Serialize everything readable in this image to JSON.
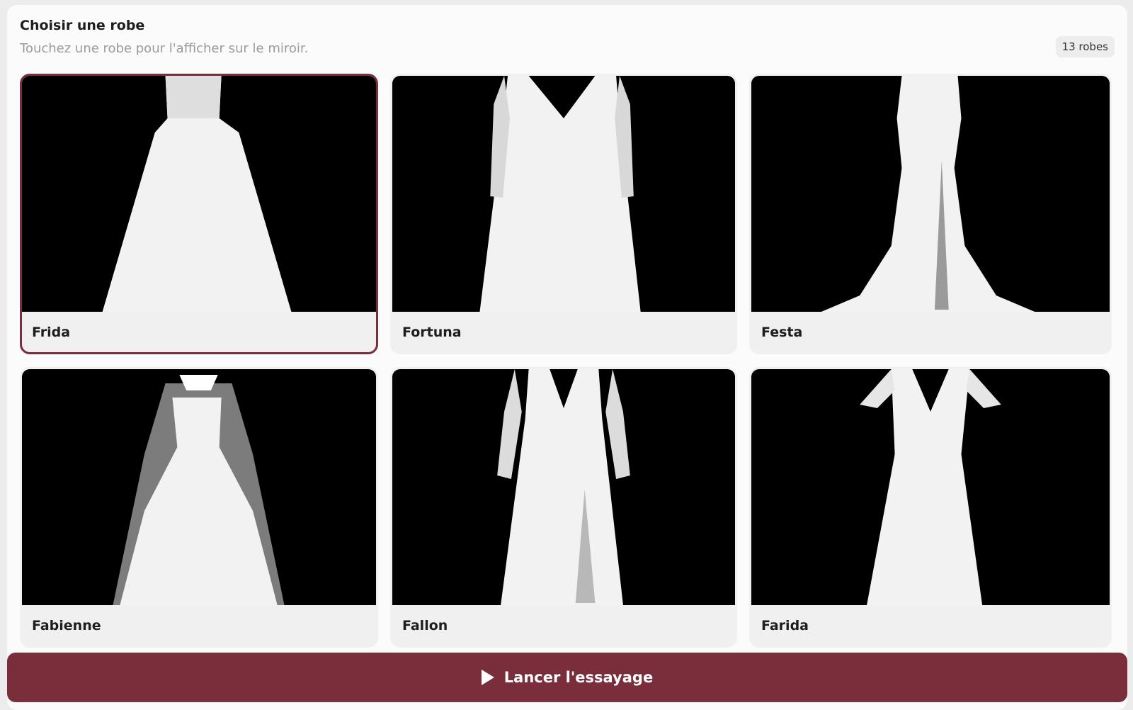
{
  "header": {
    "title": "Choisir une robe",
    "subtitle": "Touchez une robe pour l'afficher sur le miroir.",
    "count": "13 robes"
  },
  "dresses": [
    {
      "name": "Frida",
      "selected": true
    },
    {
      "name": "Fortuna",
      "selected": false
    },
    {
      "name": "Festa",
      "selected": false
    },
    {
      "name": "Fabienne",
      "selected": false
    },
    {
      "name": "Fallon",
      "selected": false
    },
    {
      "name": "Farida",
      "selected": false
    }
  ],
  "actions": {
    "launch_label": "Lancer l'essayage",
    "launch_icon": "play-icon"
  },
  "colors": {
    "accent": "#7a2d3a",
    "thumbnail_bg": "#000000"
  }
}
